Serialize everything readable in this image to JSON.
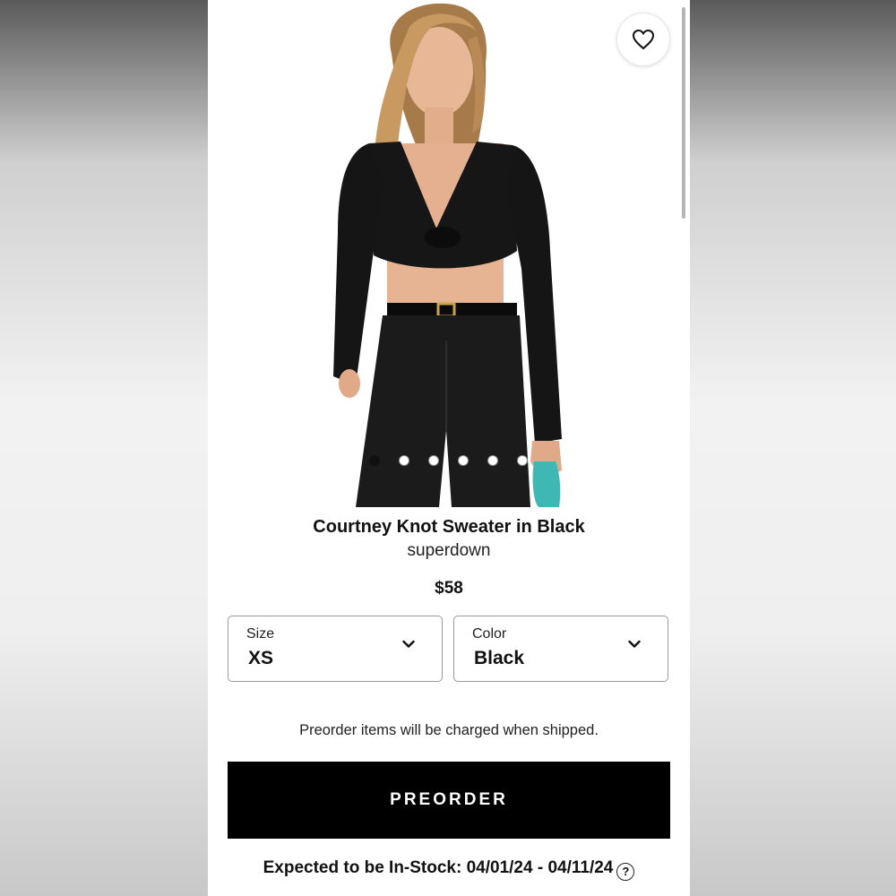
{
  "product": {
    "title": "Courtney Knot Sweater in Black",
    "brand": "superdown",
    "price": "$58",
    "image_carousel": {
      "count": 6,
      "active_index": 0
    },
    "favorite_icon": "heart-outline-icon"
  },
  "options": {
    "size": {
      "label": "Size",
      "value": "XS"
    },
    "color": {
      "label": "Color",
      "value": "Black"
    },
    "chevron_icon": "chevron-down-icon"
  },
  "notice": "Preorder items will be charged when shipped.",
  "cta": {
    "label": "PREORDER"
  },
  "availability": {
    "text": "Expected to be In-Stock: 04/01/24 - 04/11/24",
    "help_icon": "question-icon"
  },
  "colors": {
    "cta_bg": "#000000",
    "page_bg": "#ffffff",
    "garment": "#111111",
    "bag_accent": "#3fb7b5"
  }
}
